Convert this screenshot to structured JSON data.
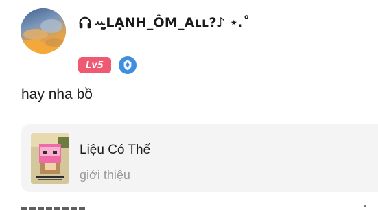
{
  "post": {
    "username": "ꕀ̤̮LẠNH_ÔM_Aʟʟ?♪ ⋆.˚",
    "level_badge": "Lv5",
    "comment": "hay nha bồ"
  },
  "song_card": {
    "title": "Liệu Có Thể",
    "subtitle": "giới thiệu"
  },
  "icons": {
    "username_prefix": "headphones-icon",
    "vip": "diamond-shield-icon",
    "more": "more-dots-icon"
  },
  "colors": {
    "level_badge_bg": "#ef5a72",
    "vip_badge_bg": "#3f8fe0",
    "card_bg": "#f4f4f5",
    "subtitle_text": "#9a9a9a"
  }
}
